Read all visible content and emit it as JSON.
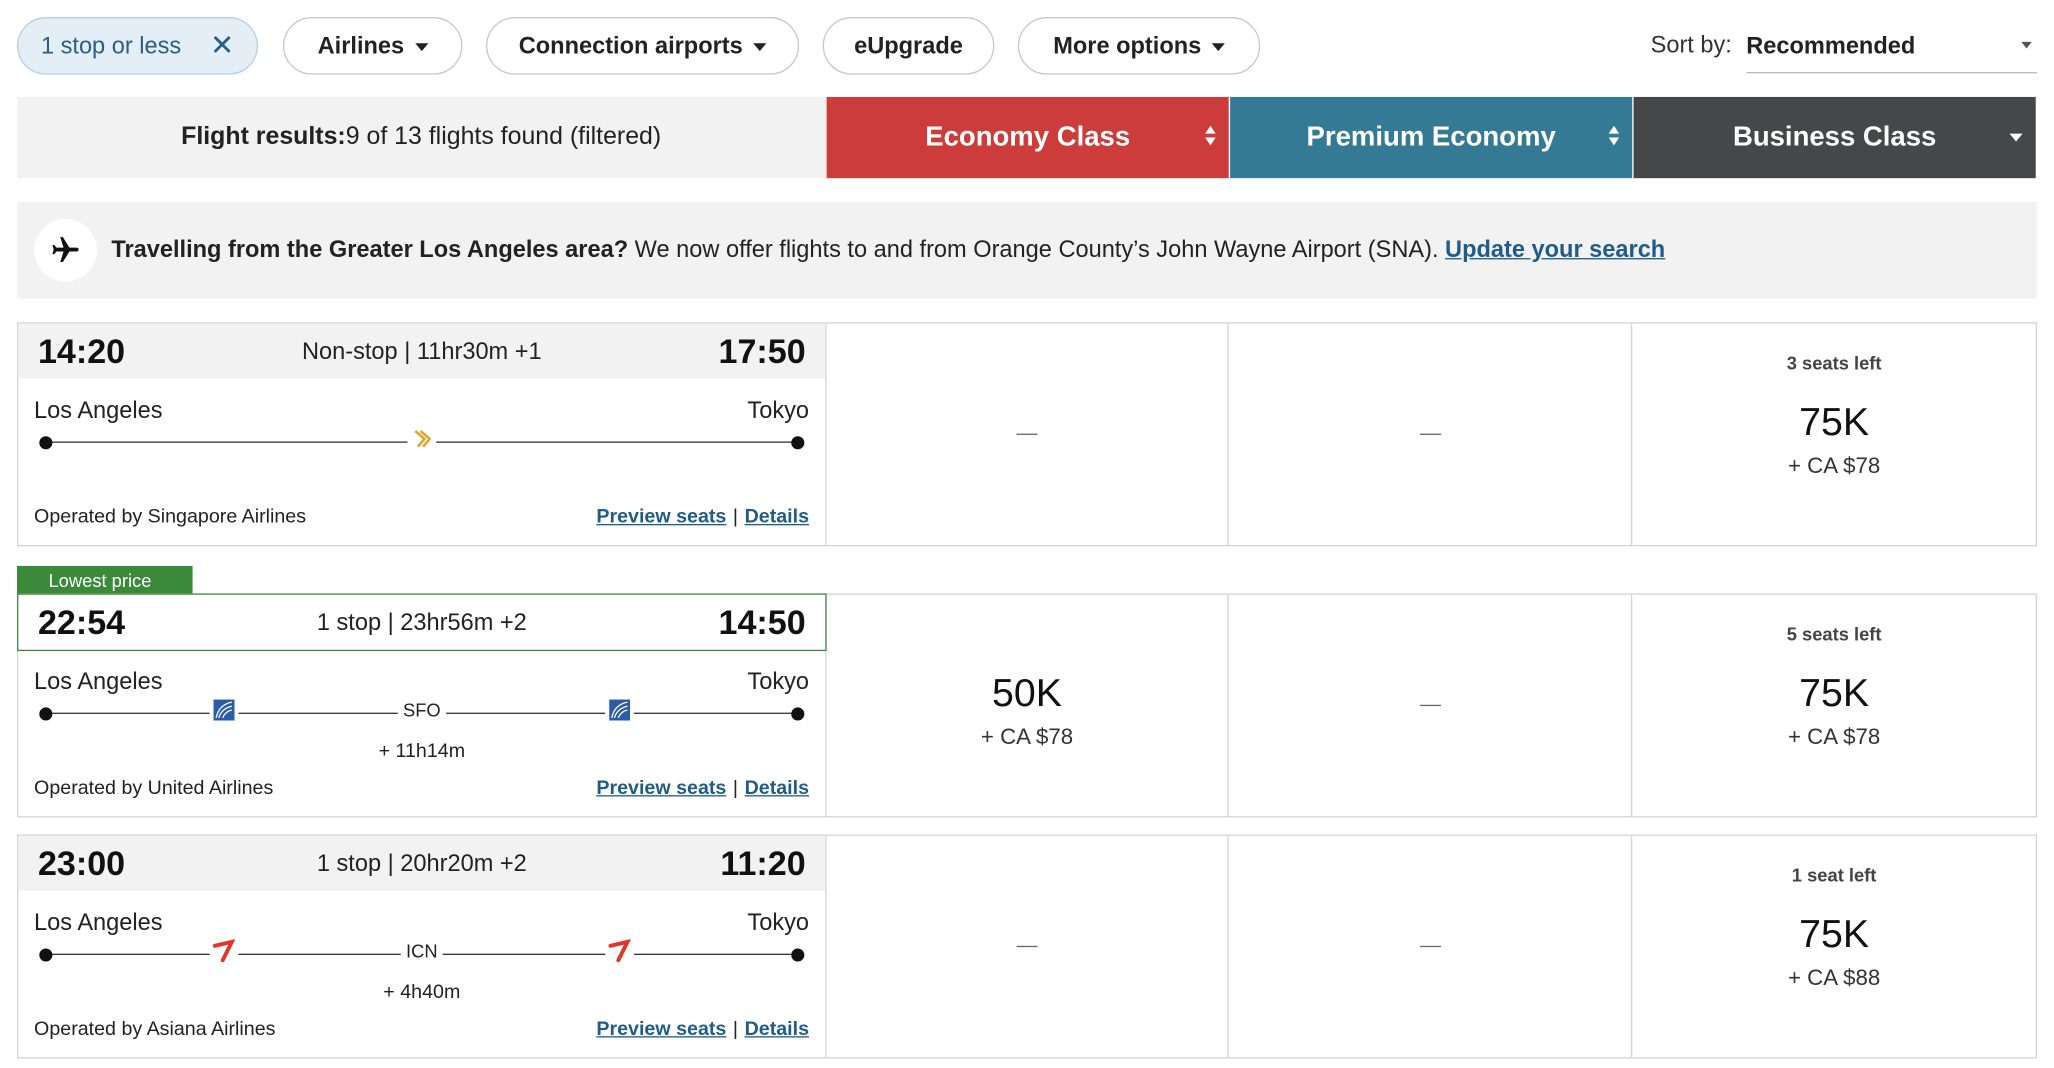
{
  "filters": {
    "stops": "1 stop or less",
    "airlines": "Airlines",
    "connections": "Connection airports",
    "eupgrade": "eUpgrade",
    "more": "More options"
  },
  "sort": {
    "label": "Sort by:",
    "value": "Recommended"
  },
  "header": {
    "results_label": "Flight results:",
    "results_count": "9 of 13 flights found (filtered)",
    "economy": "Economy Class",
    "premium": "Premium Economy",
    "business": "Business Class"
  },
  "banner": {
    "bold": "Travelling from the Greater Los Angeles area?",
    "text": " We now offer flights to and from Orange County’s John Wayne Airport (SNA). ",
    "link": "Update your search"
  },
  "badge": "Lowest price",
  "links": {
    "preview": "Preview seats",
    "sep": "|",
    "details": "Details"
  },
  "dash": "—",
  "flights": [
    {
      "dep": "14:20",
      "summary": "Non-stop | 11hr30m +1",
      "arr": "17:50",
      "from": "Los Angeles",
      "to": "Tokyo",
      "operated": "Operated by Singapore Airlines",
      "economy": null,
      "premium": null,
      "business": {
        "seats": "3 seats left",
        "pts": "75K",
        "tax": "+ CA $78"
      }
    },
    {
      "dep": "22:54",
      "summary": "1 stop | 23hr56m +2",
      "arr": "14:50",
      "from": "Los Angeles",
      "to": "Tokyo",
      "stop": "SFO",
      "layover": "+ 11h14m",
      "operated": "Operated by United Airlines",
      "economy": {
        "pts": "50K",
        "tax": "+ CA $78"
      },
      "premium": null,
      "business": {
        "seats": "5 seats left",
        "pts": "75K",
        "tax": "+ CA $78"
      }
    },
    {
      "dep": "23:00",
      "summary": "1 stop | 20hr20m +2",
      "arr": "11:20",
      "from": "Los Angeles",
      "to": "Tokyo",
      "stop": "ICN",
      "layover": "+ 4h40m",
      "operated": "Operated by Asiana Airlines",
      "economy": null,
      "premium": null,
      "business": {
        "seats": "1 seat left",
        "pts": "75K",
        "tax": "+ CA $88"
      }
    }
  ]
}
